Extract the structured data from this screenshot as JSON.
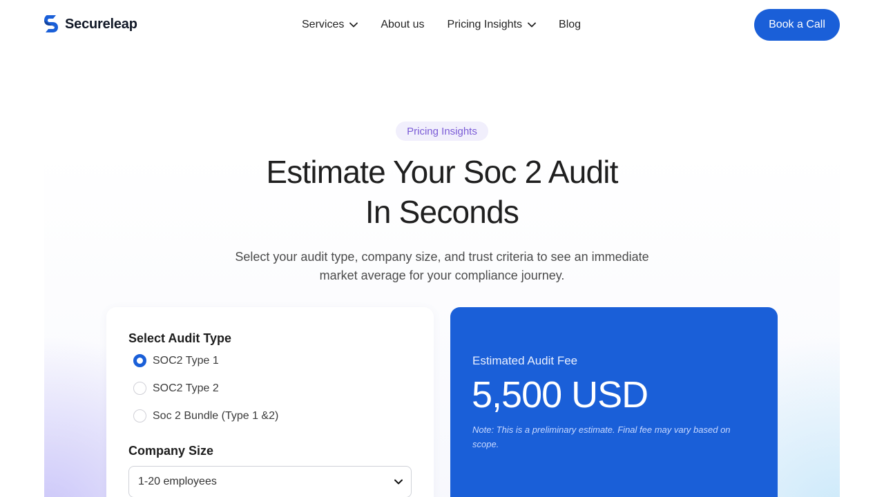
{
  "brand": {
    "name": "Secureleap",
    "accent": "#1a5fd8"
  },
  "nav": {
    "items": [
      {
        "label": "Services",
        "has_dropdown": true
      },
      {
        "label": "About us",
        "has_dropdown": false
      },
      {
        "label": "Pricing Insights",
        "has_dropdown": true
      },
      {
        "label": "Blog",
        "has_dropdown": false
      }
    ],
    "cta_label": "Book a Call"
  },
  "hero": {
    "pill": "Pricing Insights",
    "title_line1": "Estimate Your Soc 2 Audit",
    "title_line2": "In Seconds",
    "subtitle": "Select your audit type, company size, and trust criteria to see an immediate market average for your compliance journey."
  },
  "form": {
    "audit_type_label": "Select Audit Type",
    "audit_types": [
      {
        "label": "SOC2 Type 1",
        "selected": true
      },
      {
        "label": "SOC2 Type 2",
        "selected": false
      },
      {
        "label": "Soc 2 Bundle (Type 1 &2)",
        "selected": false
      }
    ],
    "company_size_label": "Company Size",
    "company_size_value": "1-20 employees"
  },
  "estimate": {
    "label": "Estimated Audit Fee",
    "value": "5,500 USD",
    "note": "Note: This is a preliminary estimate. Final fee may vary based on scope."
  }
}
